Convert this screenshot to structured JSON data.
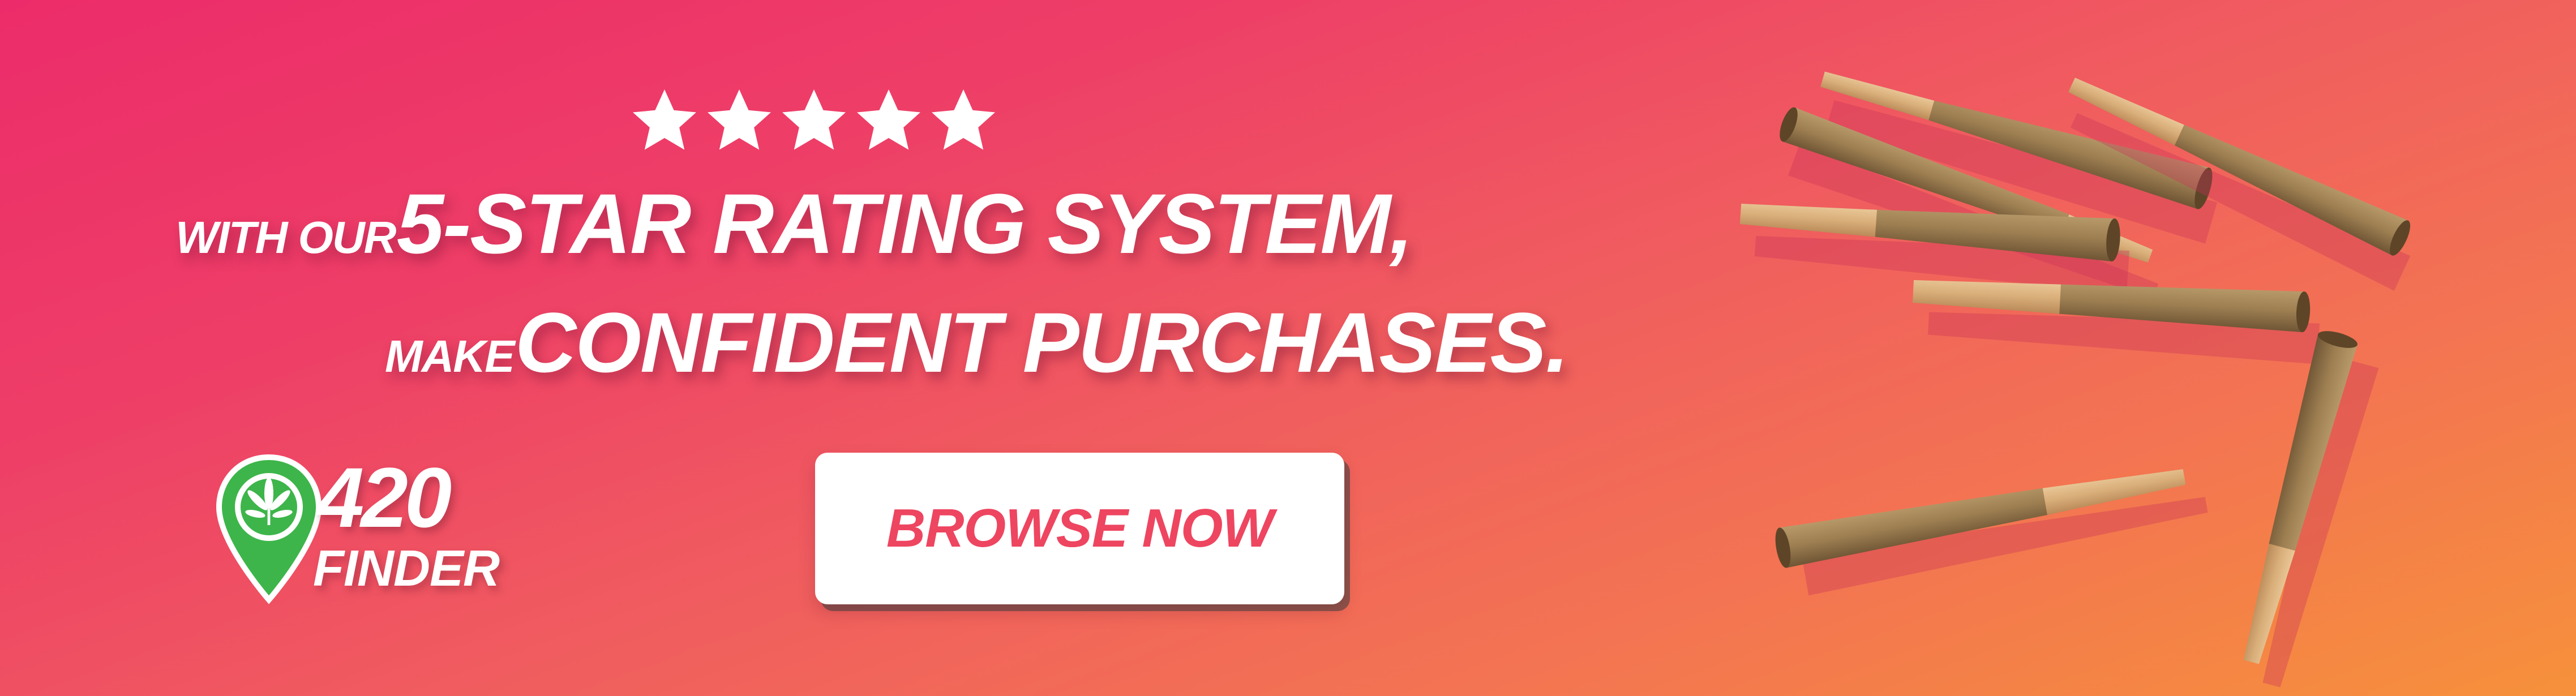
{
  "rating": {
    "stars": 5,
    "icon": "star-icon"
  },
  "headline": {
    "line1_prefix": "WITH OUR",
    "line1_main": "5-STAR RATING SYSTEM,",
    "line2_prefix": "MAKE",
    "line2_main": "CONFIDENT PURCHASES."
  },
  "logo": {
    "number": "420",
    "word": "FINDER",
    "icon": "map-pin-leaf-icon"
  },
  "cta": {
    "label": "BROWSE NOW"
  },
  "colors": {
    "gradient_start": "#ec2c6a",
    "gradient_end": "#f6913b",
    "text": "#ffffff",
    "button_bg": "#ffffff",
    "button_text": "#ee4560",
    "pin_green": "#3db54a"
  },
  "art": {
    "icon": "pre-roll-cones-illustration"
  }
}
